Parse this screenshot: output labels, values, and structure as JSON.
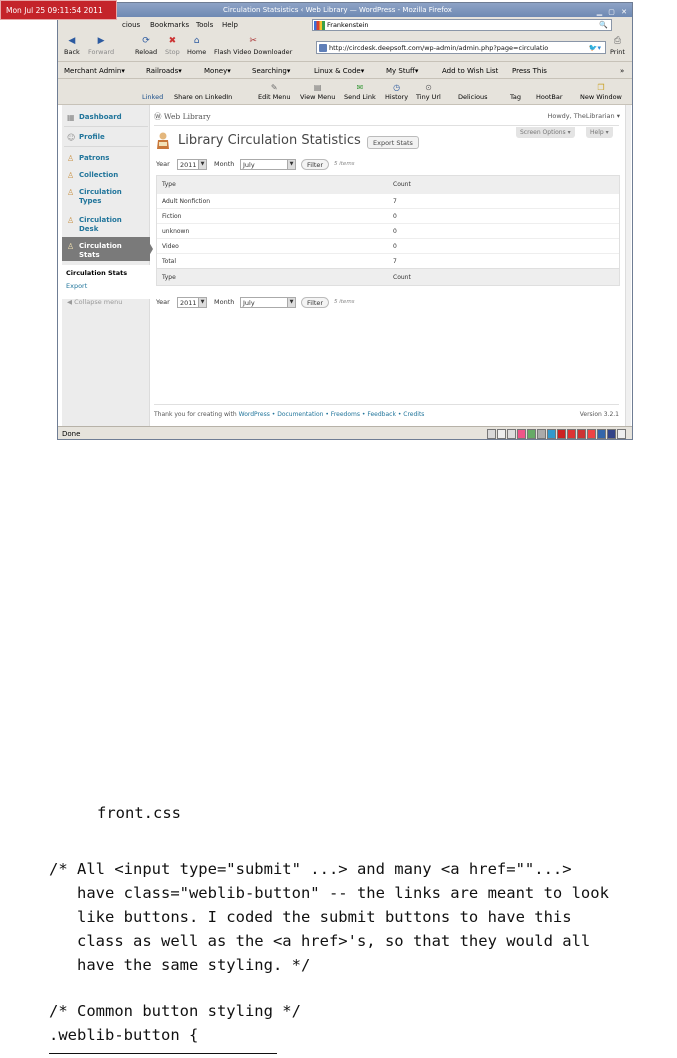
{
  "clock": "Mon Jul 25 09:11:54 2011",
  "window_title": "Circulation Statsistics ‹ Web Library — WordPress - Mozilla Firefox",
  "menu": [
    "cious",
    "Bookmarks",
    "Tools",
    "Help"
  ],
  "search_value": "Frankenstein",
  "nav": {
    "back": "Back",
    "forward": "Forward",
    "reload": "Reload",
    "stop": "Stop",
    "home": "Home",
    "flash": "Flash Video Downloader",
    "print": "Print",
    "url": "http://circdesk.deepsoft.com/wp-admin/admin.php?page=circulatio"
  },
  "bookmarks": [
    "Merchant Admin▾",
    "Railroads▾",
    "Money▾",
    "Searching▾",
    "Linux & Code▾",
    "My Stuff▾",
    "Add to Wish List",
    "Press This",
    "»"
  ],
  "addons": [
    "Linked",
    "Share on LinkedIn",
    "Edit Menu",
    "View Menu",
    "Send Link",
    "History",
    "Tiny Url",
    "Delicious",
    "Tag",
    "HootBar",
    "New Window"
  ],
  "sidebar": {
    "items": [
      {
        "label": "Dashboard"
      },
      {
        "label": "Profile"
      },
      {
        "label": "Patrons"
      },
      {
        "label": "Collection"
      },
      {
        "label": "Circulation Types"
      },
      {
        "label": "Circulation Desk"
      },
      {
        "label": "Circulation Stats"
      }
    ],
    "submenu": [
      "Circulation Stats",
      "Export"
    ],
    "collapse": "Collapse menu"
  },
  "wp": {
    "site_name": "Web Library",
    "howdy": "Howdy, TheLibrarian ▾",
    "screen_options": "Screen Options ▾",
    "help": "Help ▾",
    "page_title": "Library Circulation Statistics",
    "export_button": "Export Stats",
    "filter": {
      "year_label": "Year",
      "year": "2011",
      "month_label": "Month",
      "month": "July",
      "button": "Filter",
      "count": "5 items"
    },
    "table": {
      "headers": [
        "Type",
        "Count"
      ],
      "rows": [
        [
          "Adult Nonfiction",
          "7"
        ],
        [
          "Fiction",
          "0"
        ],
        [
          "unknown",
          "0"
        ],
        [
          "Video",
          "0"
        ],
        [
          "Total",
          "7"
        ]
      ]
    },
    "footer": {
      "thanks": "Thank you for creating with ",
      "wp": "WordPress",
      "links": "• Documentation • Freedoms • Feedback • Credits",
      "version": "Version 3.2.1"
    }
  },
  "status": "Done",
  "document": {
    "filename": "front.css",
    "comment_lines": [
      "/* All <input type=\"submit\" ...> and many <a href=\"\"...>",
      "   have class=\"weblib-button\" -- the links are meant to look",
      "   like buttons. I coded the submit buttons to have this",
      "   class as well as the <a href>'s, so that they would all",
      "   have the same styling. */"
    ],
    "code_lines": [
      "/* Common button styling */",
      ".weblib-button {"
    ]
  }
}
